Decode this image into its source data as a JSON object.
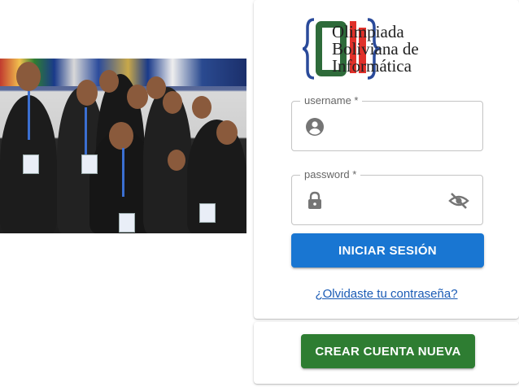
{
  "logo": {
    "line1": "Olimpiada",
    "line2": "Boliviana de",
    "line3": "Informática"
  },
  "login": {
    "username": {
      "label": "username *",
      "value": "",
      "icon": "account-circle-icon"
    },
    "password": {
      "label": "password *",
      "value": "",
      "icon": "lock-icon",
      "toggle_icon": "eye-off-icon"
    },
    "submit_label": "INICIAR SESIÓN",
    "forgot_label": "¿Olvidaste tu contraseña?"
  },
  "register": {
    "create_label": "CREAR CUENTA NUEVA"
  },
  "colors": {
    "primary": "#1976d2",
    "success": "#2e7d32",
    "logo_green": "#2e6b3a",
    "logo_red": "#e0302a",
    "logo_blue": "#2a4a9a"
  }
}
